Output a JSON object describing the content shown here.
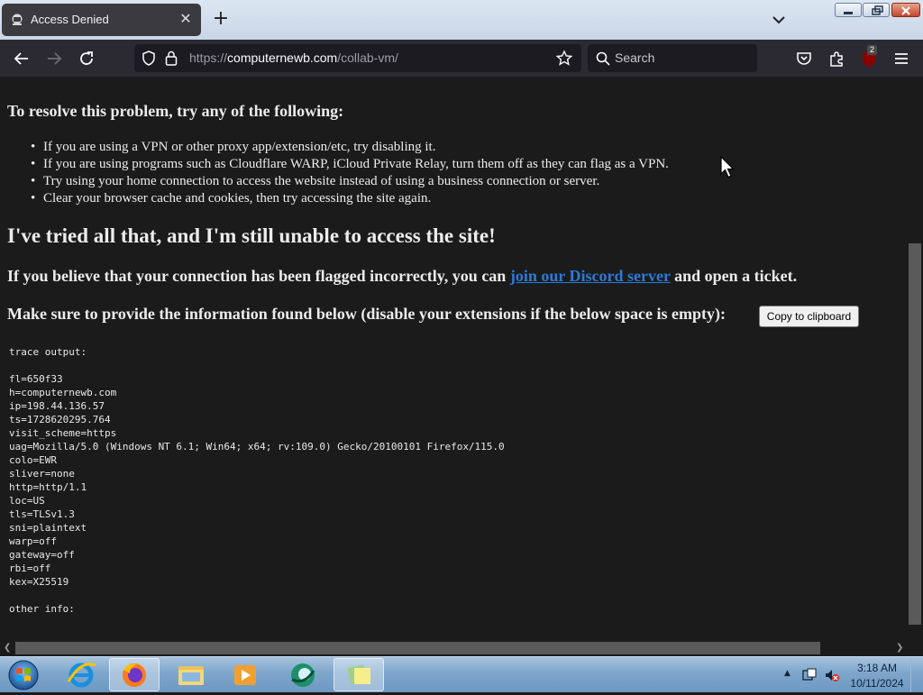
{
  "browser": {
    "tab_title": "Access Denied",
    "url_prefix": "https://",
    "url_host": "computernewb.com",
    "url_path": "/collab-vm/",
    "search_placeholder": "Search",
    "extension_badge": "2",
    "accent_color": "#2b2a33"
  },
  "page": {
    "resolve_heading": "To resolve this problem, try any of the following:",
    "tips": [
      "If you are using a VPN or other proxy app/extension/etc, try disabling it.",
      "If you are using programs such as Cloudflare WARP, iCloud Private Relay, turn them off as they can flag as a VPN.",
      "Try using your home connection to access the website instead of using a business connection or server.",
      "Clear your browser cache and cookies, then try accessing the site again."
    ],
    "tried_heading": "I've tried all that, and I'm still unable to access the site!",
    "flagged_prefix": "If you believe that your connection has been flagged incorrectly, you can ",
    "discord_link": "join our Discord server",
    "flagged_suffix": " and open a ticket.",
    "provide_text": "Make sure to provide the information found below (disable your extensions if the below space is empty):",
    "copy_button": "Copy to clipboard",
    "link_color": "#2b7ad6",
    "trace_lines": [
      "trace output:",
      "",
      "fl=650f33",
      "h=computernewb.com",
      "ip=198.44.136.57",
      "ts=1728620295.764",
      "visit_scheme=https",
      "uag=Mozilla/5.0 (Windows NT 6.1; Win64; x64; rv:109.0) Gecko/20100101 Firefox/115.0",
      "colo=EWR",
      "sliver=none",
      "http=http/1.1",
      "loc=US",
      "tls=TLSv1.3",
      "sni=plaintext",
      "warp=off",
      "gateway=off",
      "rbi=off",
      "kex=X25519",
      "",
      "other info:"
    ]
  },
  "taskbar": {
    "items": [
      "start-orb",
      "internet-explorer-icon",
      "firefox-icon",
      "file-explorer-icon",
      "media-player-icon",
      "browser-globe-icon",
      "sticky-notes-icon"
    ],
    "clock_time": "3:18 AM",
    "clock_date": "10/11/2024"
  }
}
